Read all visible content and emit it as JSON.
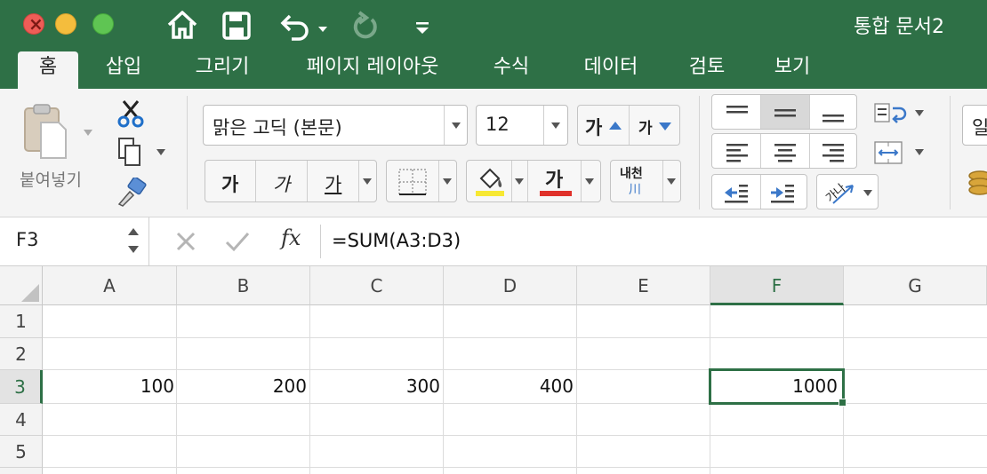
{
  "window": {
    "title": "통합 문서2"
  },
  "tabs": [
    "홈",
    "삽입",
    "그리기",
    "페이지 레이아웃",
    "수식",
    "데이터",
    "검토",
    "보기"
  ],
  "ribbon": {
    "paste_label": "붙여넣기",
    "font_name": "맑은 고딕 (본문)",
    "font_size": "12",
    "increase_font_glyph": "가",
    "decrease_font_glyph": "가",
    "bold_glyph": "가",
    "italic_glyph": "가",
    "underline_glyph": "가",
    "font_color_glyph": "가",
    "phonetic_glyph_top": "내천",
    "phonetic_glyph_bottom": "川",
    "orientation_glyph": "가나",
    "partial_next_label": "일",
    "fill_color": "#f7e833",
    "font_color": "#e0312a"
  },
  "formula_bar": {
    "cell_reference": "F3",
    "fx_label": "fx",
    "formula": "=SUM(A3:D3)"
  },
  "sheet": {
    "columns": [
      "A",
      "B",
      "C",
      "D",
      "E",
      "F",
      "G"
    ],
    "rows": [
      "1",
      "2",
      "3",
      "4",
      "5"
    ],
    "row3": {
      "A": "100",
      "B": "200",
      "C": "300",
      "D": "400",
      "F": "1000"
    },
    "accent_color": "#2e7046"
  }
}
